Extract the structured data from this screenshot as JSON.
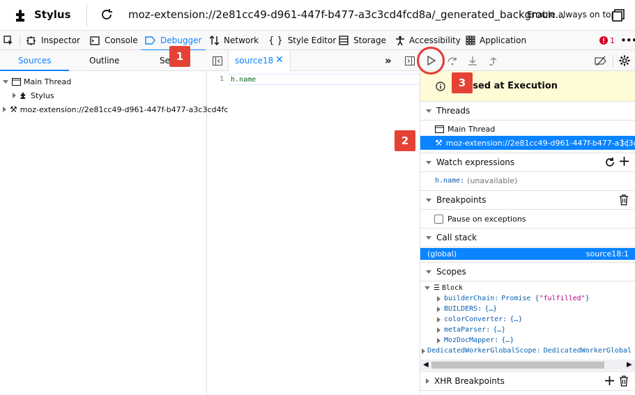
{
  "window": {
    "app_name": "Stylus",
    "url": "moz-extension://2e81cc49-d961-447f-b477-a3c3cd4fcd8a/_generated_backgroun...",
    "always_on_top_label": "Enable always on top"
  },
  "toolbar": {
    "tabs": [
      {
        "label": "Inspector"
      },
      {
        "label": "Console"
      },
      {
        "label": "Debugger",
        "selected": true
      },
      {
        "label": "Network"
      },
      {
        "label": "Style Editor"
      },
      {
        "label": "Storage"
      },
      {
        "label": "Accessibility"
      },
      {
        "label": "Application"
      }
    ],
    "error_count": "1"
  },
  "left_pane": {
    "tabs": [
      "Sources",
      "Outline",
      "Se"
    ],
    "tree": [
      {
        "label": "Main Thread"
      },
      {
        "label": "Stylus"
      },
      {
        "label": "moz-extension://2e81cc49-d961-447f-b477-a3c3cd4fc"
      }
    ]
  },
  "editor": {
    "tab_label": "source18",
    "line_number": "1",
    "code_line": "h.name"
  },
  "right_pane": {
    "paused_text": "Paused at Execution",
    "threads_header": "Threads",
    "threads": [
      {
        "label": "Main Thread"
      },
      {
        "label": "moz-extension://2e81cc49-d961-447f-b477-a3c3c..."
      }
    ],
    "watch_header": "Watch expressions",
    "watch_name": "h.name",
    "watch_value": "(unavailable)",
    "breakpoints_header": "Breakpoints",
    "pause_on_exceptions": "Pause on exceptions",
    "callstack_header": "Call stack",
    "callstack_frame": "(global)",
    "callstack_location": "source18:1",
    "scopes_header": "Scopes",
    "scope_block": "Block",
    "scopes": [
      {
        "name": "builderChain",
        "value": "Promise { ",
        "extra": "\"fulfilled\"",
        "tail": " }"
      },
      {
        "name": "BUILDERS",
        "value": "{…}"
      },
      {
        "name": "colorConverter",
        "value": "{…}"
      },
      {
        "name": "metaParser",
        "value": "{…}"
      },
      {
        "name": "MozDocMapper",
        "value": "{…}"
      }
    ],
    "global_scope_name": "DedicatedWorkerGlobalScope",
    "global_scope_value": "DedicatedWorkerGlobal",
    "xhr_header": "XHR Breakpoints"
  },
  "annotations": [
    "1",
    "2",
    "3"
  ],
  "colors": {
    "accent": "#0a84ff",
    "badge": "#e34234",
    "paused_bg": "#fffbd6"
  }
}
